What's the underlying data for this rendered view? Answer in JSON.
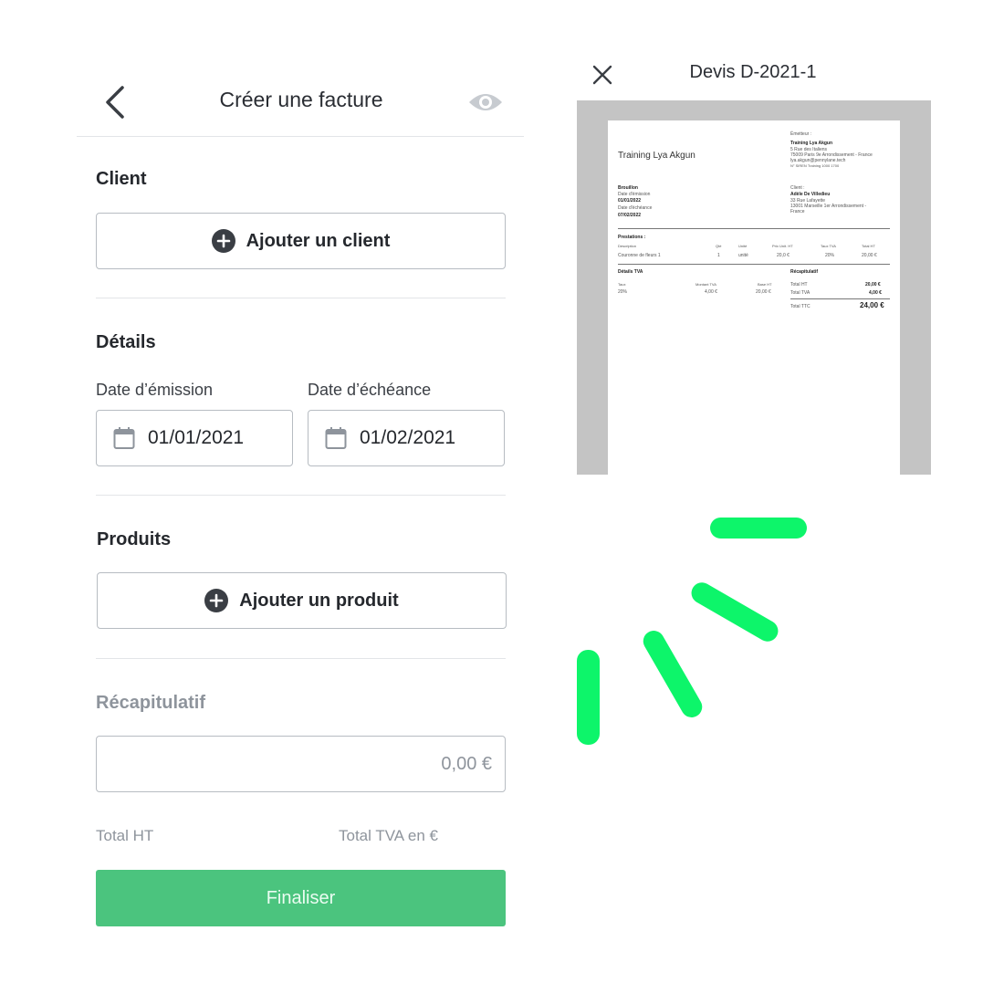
{
  "header": {
    "title": "Créer une facture",
    "back_icon": "chevron-left-icon",
    "preview_icon": "eye-icon"
  },
  "client": {
    "heading": "Client",
    "add_label": "Ajouter un client"
  },
  "details": {
    "heading": "Détails",
    "issue_label": "Date d’émission",
    "issue_value": "01/01/2021",
    "due_label": "Date d’échéance",
    "due_value": "01/02/2021"
  },
  "products": {
    "heading": "Produits",
    "add_label": "Ajouter un produit"
  },
  "summary": {
    "heading": "Récapitulatif",
    "amount": "0,00 €",
    "total_ht_label": "Total HT",
    "total_tva_label": "Total TVA en €"
  },
  "finalize_label": "Finaliser",
  "preview": {
    "title": "Devis D-2021-1",
    "close_icon": "close-icon",
    "doc": {
      "company": "Training Lya Akgun",
      "emitter_label": "Émetteur :",
      "emitter_name": "Training Lya Akgun",
      "emitter_addr1": "5 Rue des Italiens",
      "emitter_addr2": "75009 Paris 9e Arrondissement - France",
      "emitter_email": "lya.akgun@pennylane.tech",
      "emitter_siren": "N° SIREN Training 1000 1700",
      "status": "Brouillon",
      "issue_label": "Date d'émission",
      "issue_value": "01/01/2022",
      "due_label": "Date d'échéance",
      "due_value": "07/02/2022",
      "client_label": "Client :",
      "client_name": "Adèle De Villedieu",
      "client_addr1": "33 Rue Lafayette",
      "client_addr2": "13001 Marseille 1er Arrondissement -",
      "client_addr3": "France",
      "services_heading": "Prestations :",
      "cols": [
        "Description",
        "Qté",
        "Unité",
        "Prix Unit. HT",
        "Taux TVA",
        "Total HT"
      ],
      "row": [
        "Couronne de fleurs 1",
        "1",
        "unité",
        "20,0 €",
        "20%",
        "20,00 €"
      ],
      "tva_heading": "Détails TVA",
      "tva_cols": [
        "Taux",
        "Montant TVA",
        "Base HT"
      ],
      "tva_row": [
        "20%",
        "4,00 €",
        "20,00 €"
      ],
      "recap_heading": "Récapitulatif",
      "recap_ht_label": "Total HT",
      "recap_ht_value": "20,00 €",
      "recap_tva_label": "Total TVA",
      "recap_tva_value": "4,00 €",
      "recap_ttc_label": "Total TTC",
      "recap_ttc_value": "24,00 €"
    }
  },
  "colors": {
    "accent_green": "#4bc47e",
    "spinner_green": "#0df56a",
    "preview_bg": "#c4c4c4"
  }
}
